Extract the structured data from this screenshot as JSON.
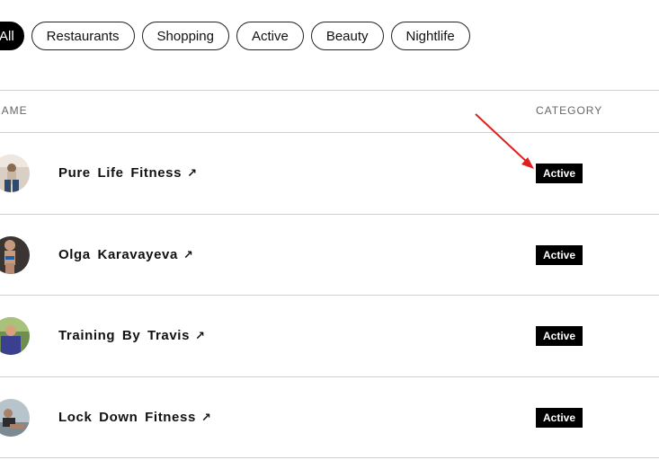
{
  "filters": [
    {
      "label": "All",
      "active": true
    },
    {
      "label": "Restaurants",
      "active": false
    },
    {
      "label": "Shopping",
      "active": false
    },
    {
      "label": "Active",
      "active": false
    },
    {
      "label": "Beauty",
      "active": false
    },
    {
      "label": "Nightlife",
      "active": false
    }
  ],
  "table": {
    "headers": {
      "name": "NAME",
      "category": "CATEGORY"
    },
    "rows": [
      {
        "name": "Pure Life Fitness",
        "category": "Active",
        "avatar": "avatar-photo-1"
      },
      {
        "name": "Olga Karavayeva",
        "category": "Active",
        "avatar": "avatar-photo-2"
      },
      {
        "name": "Training By Travis",
        "category": "Active",
        "avatar": "avatar-photo-3"
      },
      {
        "name": "Lock Down Fitness",
        "category": "Active",
        "avatar": "avatar-photo-4"
      }
    ]
  },
  "icons": {
    "external_link": "↗"
  },
  "colors": {
    "badge_bg": "#000000",
    "annotation_arrow": "#e0201e",
    "divider": "#cfcfcf"
  }
}
